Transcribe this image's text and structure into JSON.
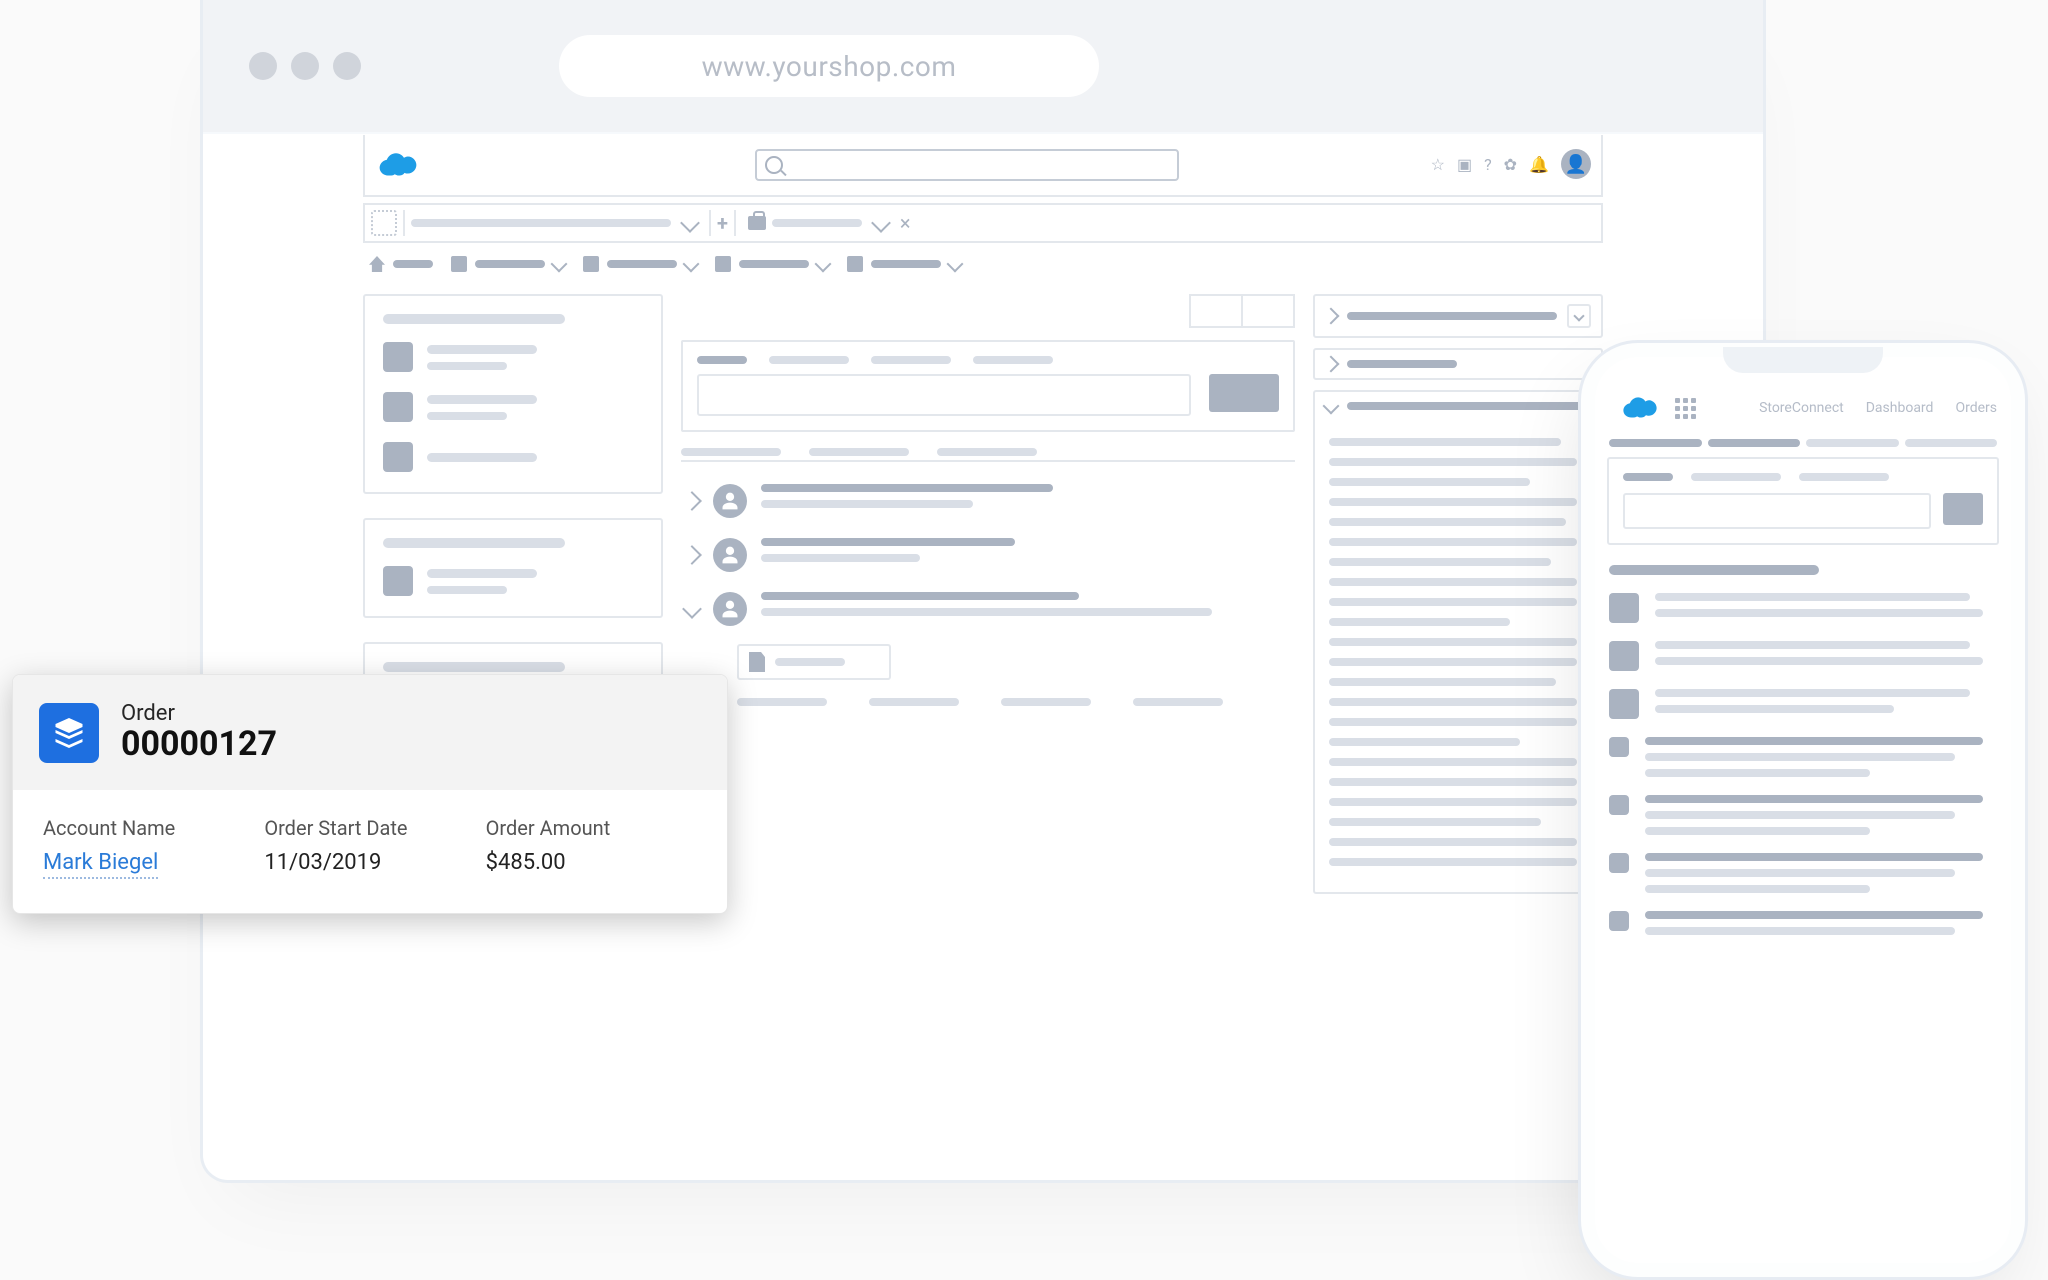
{
  "browser": {
    "address": "www.yourshop.com"
  },
  "order": {
    "label": "Order",
    "number": "00000127",
    "fields": {
      "account_name": {
        "label": "Account Name",
        "value": "Mark Biegel"
      },
      "start_date": {
        "label": "Order Start Date",
        "value": "11/03/2019"
      },
      "amount": {
        "label": "Order Amount",
        "value": "$485.00"
      }
    }
  },
  "phone": {
    "tabs": [
      "StoreConnect",
      "Dashboard",
      "Orders"
    ]
  }
}
